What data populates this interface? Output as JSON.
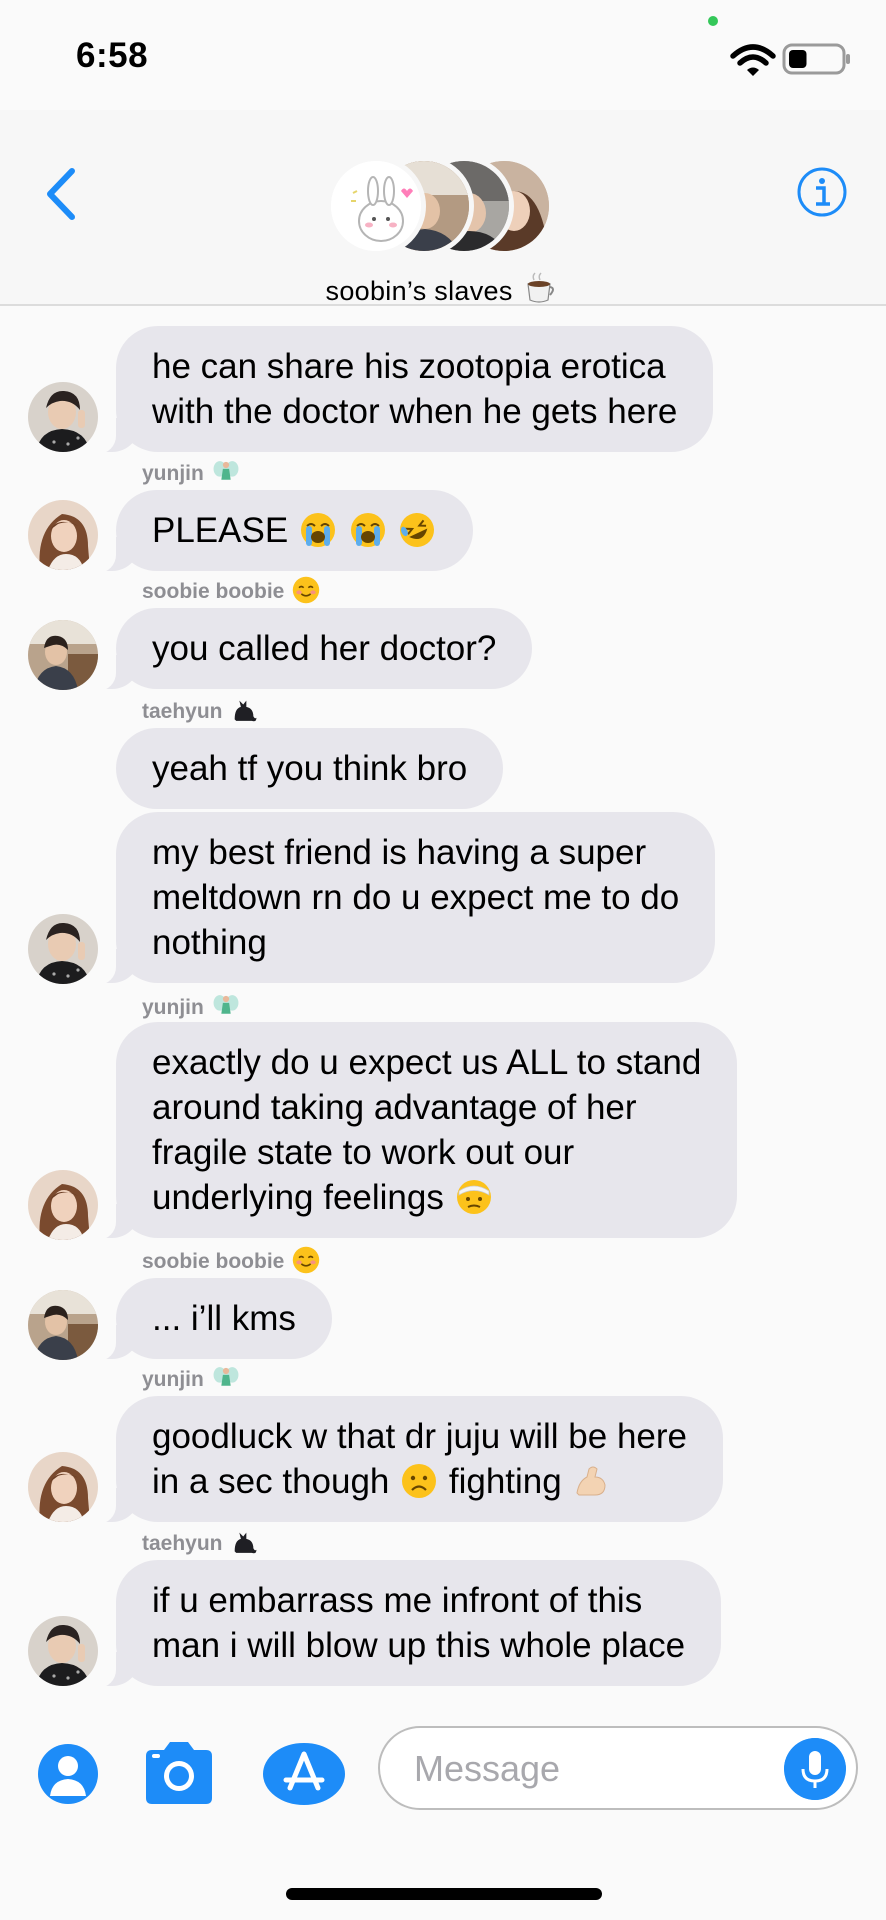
{
  "status_bar": {
    "time": "6:58",
    "battery_level": 0.35
  },
  "header": {
    "group_name": "soobin’s slaves",
    "group_name_emoji_icon": "coffee-cup-icon",
    "back_icon": "chevron-left-icon",
    "info_icon": "info-circle-icon"
  },
  "colors": {
    "accent": "#1d8cf8",
    "bubble": "#e7e6ec",
    "background": "#fafafa",
    "sender_label": "#8e8e93"
  },
  "messages": [
    {
      "lines": [
        "he can share his zootopia erotica",
        "with the doctor when he gets here"
      ],
      "avatar": "taehyun"
    },
    {
      "sender": "yunjin",
      "sender_emoji_icon": "fairy-icon",
      "lines": [
        "PLEASE"
      ],
      "emojis": [
        "loudly-crying-face-icon",
        "loudly-crying-face-icon",
        "rolling-laughing-face-icon"
      ],
      "avatar": "yunjin"
    },
    {
      "sender": "soobie boobie",
      "sender_emoji_icon": "smiling-face-icon",
      "lines": [
        "you called her doctor?"
      ],
      "avatar": "soobin"
    },
    {
      "sender": "taehyun",
      "sender_emoji_icon": "black-cat-icon",
      "lines": [
        "yeah tf you think bro"
      ]
    },
    {
      "lines": [
        "my best friend is having a super",
        "meltdown rn do u expect me to do",
        "nothing"
      ],
      "avatar": "taehyun"
    },
    {
      "sender": "yunjin",
      "sender_emoji_icon": "fairy-icon",
      "lines": [
        "exactly do u expect us ALL to stand",
        "around taking advantage of her",
        "fragile state to work out our",
        "underlying feelings"
      ],
      "emojis": [
        "bandaged-face-icon"
      ],
      "avatar": "yunjin"
    },
    {
      "sender": "soobie boobie",
      "sender_emoji_icon": "smiling-face-icon",
      "lines": [
        "... i’ll kms"
      ],
      "avatar": "soobin"
    },
    {
      "sender": "yunjin",
      "sender_emoji_icon": "fairy-icon",
      "lines": [
        "goodluck w that dr juju will be here",
        "in a sec though",
        "fighting"
      ],
      "emojis": [
        "frowning-face-icon",
        "flexed-biceps-icon"
      ],
      "avatar": "yunjin"
    },
    {
      "sender": "taehyun",
      "sender_emoji_icon": "black-cat-icon",
      "lines": [
        "if u embarrass me infront of this",
        "man i will blow up this whole place"
      ],
      "avatar": "taehyun"
    }
  ],
  "input": {
    "placeholder": "Message"
  },
  "toolbar_icons": [
    "memoji-icon",
    "camera-icon",
    "app-store-icon",
    "microphone-icon"
  ]
}
